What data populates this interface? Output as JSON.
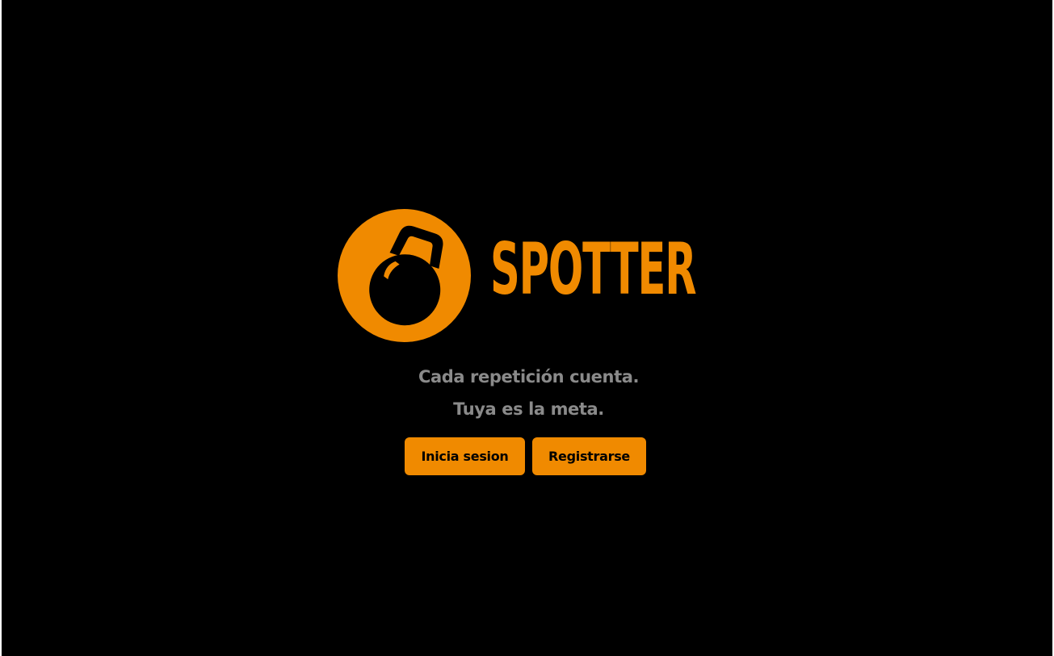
{
  "theme": {
    "background": "#000000",
    "accent": "#F08A00",
    "tagline_color": "#8A8A8A",
    "button_text_color": "#000000"
  },
  "brand": {
    "logo_icon": "kettlebell-icon",
    "name": "SPOTTER"
  },
  "hero": {
    "tagline_line1": "Cada repetición cuenta.",
    "tagline_line2": "Tuya es la meta."
  },
  "actions": {
    "login_label": "Inicia sesion",
    "register_label": "Registrarse"
  }
}
